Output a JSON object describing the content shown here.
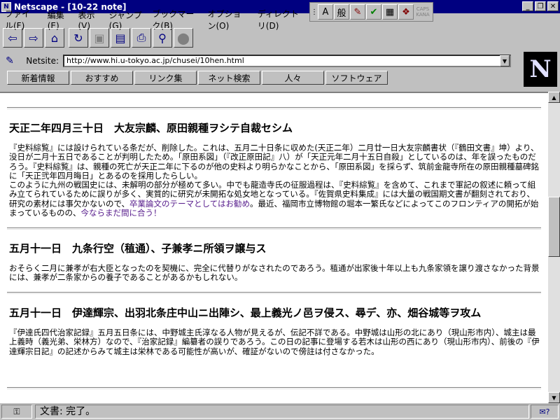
{
  "window": {
    "title": "Netscape - [10-22 note]"
  },
  "ime": {
    "buttons": [
      "A",
      "般"
    ],
    "caps": "CAPS KANA"
  },
  "menu": [
    "ファイル(F)",
    "編集(E)",
    "表示(V)",
    "ジャンプ(G)",
    "ブックマーク(B)",
    "オプション(O)",
    "ディレクトリ(D)"
  ],
  "location": {
    "label": "Netsite:",
    "url": "http://www.hi.u-tokyo.ac.jp/chusei/10hen.html"
  },
  "directory_buttons": [
    "新着情報",
    "おすすめ",
    "リンク集",
    "ネット検索",
    "人々",
    "ソフトウェア"
  ],
  "logo": "N",
  "sections": [
    {
      "title": "天正二年四月三十日　大友宗麟、原田親種ヲシテ自裁セシム",
      "body_before_link": "『史料綜覧』には設けられている条だが、削除した。これは、五月二十日条に収めた(天正二年）二月廿一日大友宗麟書状（『鶴田文書』坤）より、没日が二月十五日であることが判明したため。「原田系図」（『改正原田記』八）が「天正元年二月十五日自殺」としているのは、年を誤ったものだろう。『史料綜覧』は、親種の死亡が天正二年に下るのが他の史料より明らかなことから、「原田系図」を採らず、筑前金龍寺所在の原田親種墓碑銘に「天正弐年四月晦日」とあるのを採用したらしい。\nこのように九州の戦国史には、未解明の部分が極めて多い。中でも龍造寺氏の征服過程は、『史料綜覧』を含めて、これまで軍記の叙述に頼って組み立てられているために誤りが多く、実質的に研究が未開拓な処女地となっている。『佐賀県史料集成』には大量の戦国期文書が翻刻されており、研究の素材には事欠かないので、",
      "link_text": "卒業論文のテーマとしてはお勧め",
      "body_middle": "。最近、福岡市立博物館の堀本一繁氏などによってこのフロンティアの開拓が始まっているものの、",
      "link_text_2": "今ならまだ間に合う！"
    },
    {
      "title": "五月十一日　九条行空（稙通）、子兼孝ニ所領ヲ譲与ス",
      "body": "おそらく二月に兼孝が右大臣となったのを契機に、完全に代替りがなされたのであろう。稙通が出家後十年以上も九条家領を譲り渡さなかった背景には、兼孝が二条家からの養子であることがあるかもしれない。"
    },
    {
      "title": "五月十一日　伊達輝宗、出羽北条庄中山ニ出陣シ、最上義光ノ邑ヲ侵ス、尋デ、亦、畑谷城等ヲ攻ム",
      "body": "『伊達氏四代治家記録』五月五日条には、中野城主氏淳なる人物が見えるが、伝記不詳である。中野城は山形の北にあり（現山形市内）、城主は最上義時（義光弟、栄林方）なので、『治家記録』編纂者の誤りであろう。この日の記事に登場する若木は山形の西にあり（現山形市内）、前後の『伊達輝宗日記』の記述からみて城主は栄林である可能性が高いが、確証がないので傍註は付さなかった。"
    }
  ],
  "status": {
    "text": "文書: 完了。"
  }
}
